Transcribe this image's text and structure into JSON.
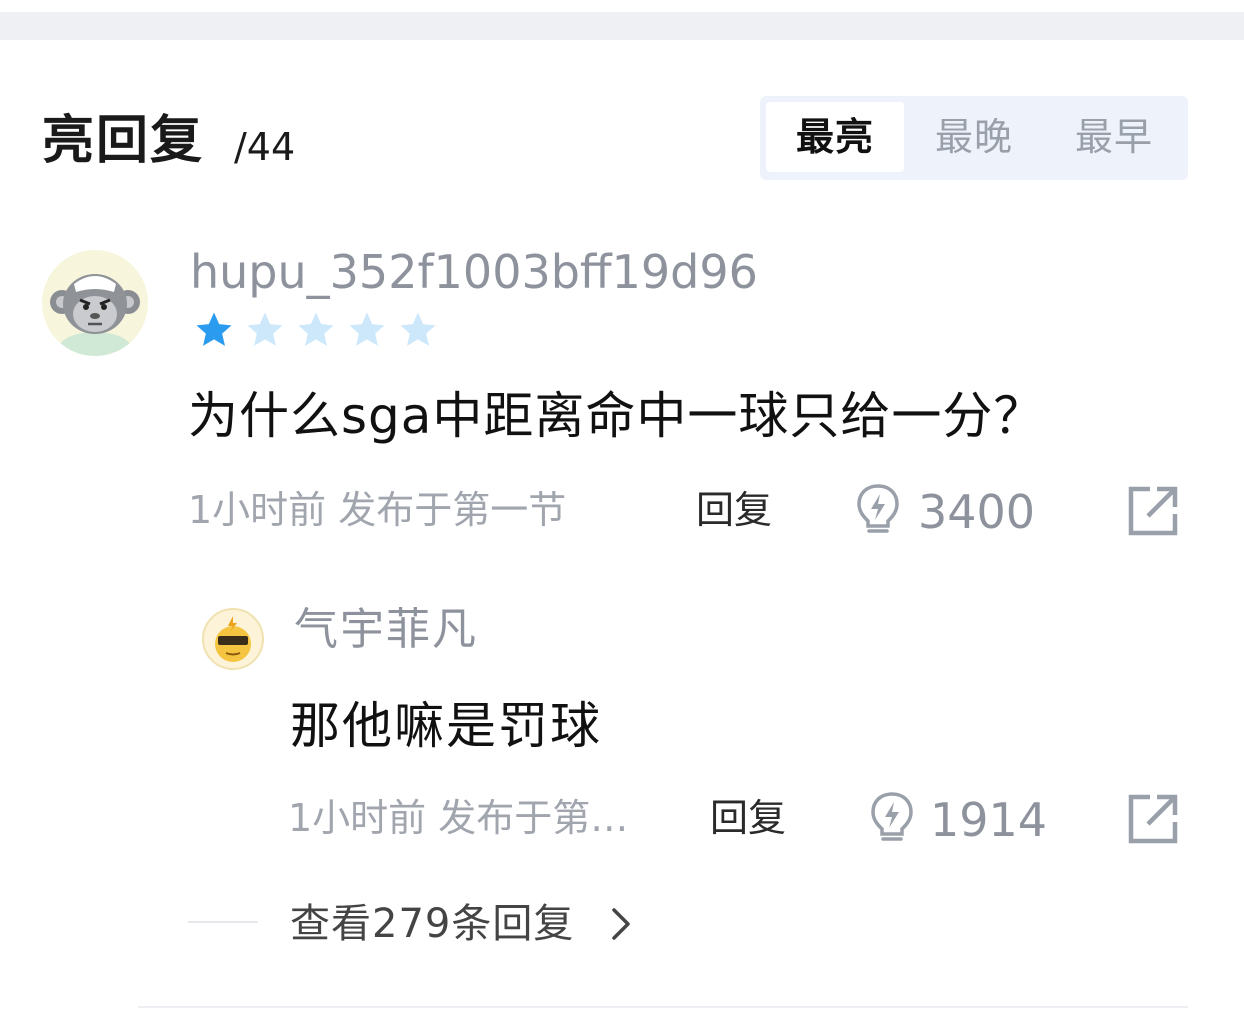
{
  "header": {
    "title": "亮回复",
    "count": "/44",
    "sort_tabs": [
      {
        "label": "最亮",
        "active": true
      },
      {
        "label": "最晚",
        "active": false
      },
      {
        "label": "最早",
        "active": false
      }
    ]
  },
  "comment": {
    "username": "hupu_352f1003bff19d96",
    "rating": 1,
    "rating_max": 5,
    "text": "为什么sga中距离命中一球只给一分？",
    "meta": "1小时前 发布于第一节",
    "reply_label": "回复",
    "light_count": "3400"
  },
  "reply": {
    "username": "气宇菲凡",
    "text": "那他嘛是罚球",
    "meta": "1小时前 发布于第…",
    "reply_label": "回复",
    "light_count": "1914"
  },
  "more_replies": "查看279条回复",
  "colors": {
    "star_active": "#2b9bf0",
    "star_inactive": "#c9e6fb",
    "accent_bg": "#eef2fb"
  }
}
